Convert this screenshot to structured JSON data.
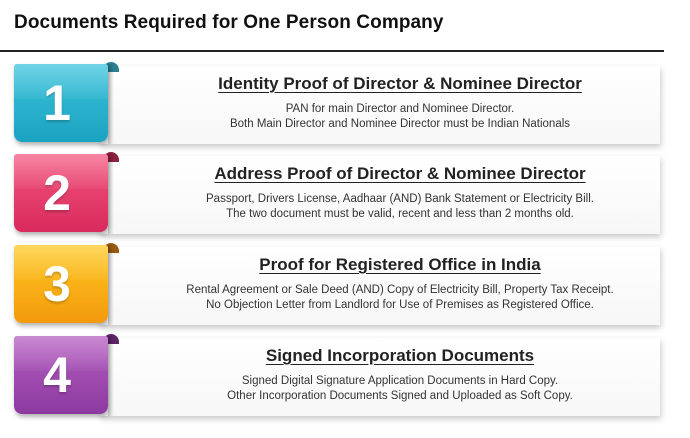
{
  "title": "Documents Required for One Person Company",
  "steps": [
    {
      "number": "1",
      "heading": "Identity Proof of Director & Nominee Director",
      "lines": [
        "PAN for main Director and Nominee Director.",
        "Both Main Director and Nominee Director must be Indian Nationals"
      ],
      "color_top": "#3cc3dc",
      "color_bottom": "#1aa3c0",
      "fold_color": "#2a7f93"
    },
    {
      "number": "2",
      "heading": "Address Proof of Director & Nominee Director",
      "lines": [
        "Passport, Drivers License, Aadhaar (AND) Bank Statement or Electricity Bill.",
        "The two document must be valid, recent and less than 2 months old."
      ],
      "color_top": "#f3577f",
      "color_bottom": "#d82a5c",
      "fold_color": "#8d1f3f"
    },
    {
      "number": "3",
      "heading": "Proof for Registered Office in India",
      "lines": [
        "Rental Agreement or Sale Deed (AND) Copy of Electricity Bill, Property Tax Receipt.",
        "No Objection Letter from Landlord for Use of Premises as Registered Office."
      ],
      "color_top": "#ffc820",
      "color_bottom": "#f29a0c",
      "fold_color": "#9a5a12"
    },
    {
      "number": "4",
      "heading": "Signed Incorporation Documents",
      "lines": [
        "Signed Digital Signature Application Documents in Hard Copy.",
        "Other Incorporation Documents Signed and Uploaded as Soft Copy."
      ],
      "color_top": "#b45dc0",
      "color_bottom": "#8c3aa0",
      "fold_color": "#5e2468"
    }
  ]
}
